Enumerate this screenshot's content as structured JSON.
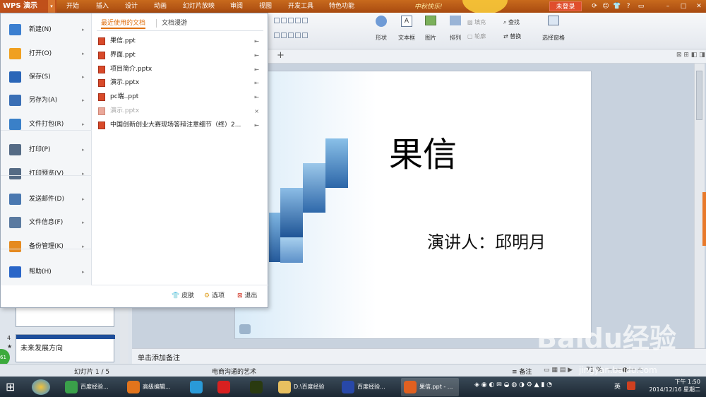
{
  "app": {
    "menu_button": "WPS 演示",
    "festival": "中秋快乐!",
    "login": "未登录"
  },
  "tabs": [
    "开始",
    "插入",
    "设计",
    "动画",
    "幻灯片放映",
    "审阅",
    "视图",
    "开发工具",
    "特色功能"
  ],
  "ribbon": {
    "fill": "填充",
    "outline": "轮廓",
    "shape": "形状",
    "textbox": "文本框",
    "picture": "图片",
    "arrange": "排列",
    "find": "查找",
    "replace": "替换",
    "select_pane": "选择窗格"
  },
  "menu": {
    "items": [
      {
        "label": "新建(N)",
        "icon": "new-icon",
        "color": "#3b7fd0"
      },
      {
        "label": "打开(O)",
        "icon": "open-folder-icon",
        "color": "#f0a020"
      },
      {
        "label": "保存(S)",
        "icon": "save-icon",
        "color": "#2a66b8"
      },
      {
        "label": "另存为(A)",
        "icon": "save-as-icon",
        "color": "#3a6fb5"
      },
      {
        "label": "文件打包(R)",
        "icon": "package-icon",
        "color": "#3a80c8"
      },
      {
        "label": "打印(P)",
        "icon": "print-icon",
        "color": "#556b85"
      },
      {
        "label": "打印预览(V)",
        "icon": "print-preview-icon",
        "color": "#556b85"
      },
      {
        "label": "发送邮件(D)",
        "icon": "mail-icon",
        "color": "#4a78b0"
      },
      {
        "label": "文件信息(F)",
        "icon": "file-info-icon",
        "color": "#5a7aa0"
      },
      {
        "label": "备份管理(K)",
        "icon": "backup-icon",
        "color": "#e58a20"
      },
      {
        "label": "帮助(H)",
        "icon": "help-icon",
        "color": "#2a66c8"
      }
    ],
    "tab_recent": "最近使用的文档",
    "tab_roaming": "文档漫游",
    "files": [
      {
        "name": "果信.ppt",
        "faded": false,
        "pin": "⇤"
      },
      {
        "name": "界面.ppt",
        "faded": false,
        "pin": "⇤"
      },
      {
        "name": "项目简介.pptx",
        "faded": false,
        "pin": "⇤"
      },
      {
        "name": "演示.pptx",
        "faded": false,
        "pin": "⇤"
      },
      {
        "name": "pc端..ppt",
        "faded": false,
        "pin": "⇤"
      },
      {
        "name": "演示.pptx",
        "faded": true,
        "pin": "×"
      },
      {
        "name": "中国创新创业大赛现场答辩注意细节（终）2...",
        "faded": false,
        "pin": "⇤"
      }
    ],
    "skin": "皮肤",
    "options": "选项",
    "exit": "退出"
  },
  "slide": {
    "title": "果信",
    "subtitle": "演讲人：邱明月"
  },
  "thumb4": {
    "number": "4",
    "text": "未来发展方向",
    "star": "★"
  },
  "notes_placeholder": "单击添加备注",
  "status": {
    "slide_counter": "幻灯片 1 / 5",
    "theme": "电商沟通的艺术",
    "notes": "备注",
    "zoom": "71 %",
    "watermark": "Baidu经验",
    "watermark_url": "jingyan.baidu.com"
  },
  "taskbar": {
    "items": [
      {
        "label": "百度经验...",
        "color": "#3aa04a"
      },
      {
        "label": "高级编辑...",
        "color": "#e2741c"
      },
      {
        "label": "",
        "color": "#2a9ad8"
      },
      {
        "label": "",
        "color": "#d82020"
      },
      {
        "label": "",
        "color": "#2a3a10"
      },
      {
        "label": "D:\\百度经验",
        "color": "#e8c060"
      },
      {
        "label": "百度经验...",
        "color": "#2848a8"
      },
      {
        "label": "果信.ppt - ...",
        "color": "#e06020"
      }
    ],
    "time": "下午 1:50",
    "date": "2014/12/16 星期二",
    "ime": "英"
  }
}
